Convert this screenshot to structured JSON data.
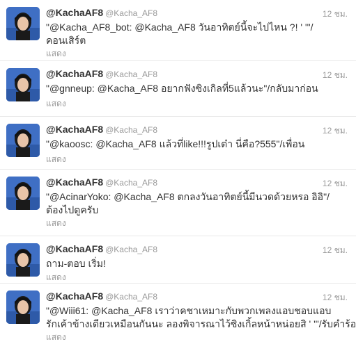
{
  "tweets": [
    {
      "name": "@KachaAF8",
      "handle": "@Kacha_AF8",
      "time": "12 ชม.",
      "lines": [
        "\"@Kacha_AF8_bot: @Kacha_AF8 วันอาทิตย์นี้จะไปไหน ?! ' '\"/",
        "คอนเสิร์ต"
      ],
      "expand": "แสดง"
    },
    {
      "name": "@KachaAF8",
      "handle": "@Kacha_AF8",
      "time": "12 ชม.",
      "lines": [
        "\"@gnneup: @Kacha_AF8 อยากฟังซิงเกิลที่5แล้วนะ\"/กลับมาก่อน"
      ],
      "expand": "แสดง"
    },
    {
      "name": "@KachaAF8",
      "handle": "@Kacha_AF8",
      "time": "12 ชม.",
      "lines": [
        "\"@kaoosc: @Kacha_AF8 แล้วที่like!!!รูปเต๋า นี่คือ?555\"/เพื่อน"
      ],
      "expand": "แสดง"
    },
    {
      "name": "@KachaAF8",
      "handle": "@Kacha_AF8",
      "time": "12 ชม.",
      "lines": [
        "\"@AcinarYoko: @Kacha_AF8 ตกลงวันอาทิตย์นี้มีนวดด้วยหรอ อิอิ\"/",
        "ต้องไปดูครับ"
      ],
      "expand": "แสดง"
    },
    {
      "name": "@KachaAF8",
      "handle": "@Kacha_AF8",
      "time": "12 ชม.",
      "lines": [
        "ถาม-ตอบ เริ่ม!"
      ],
      "expand": "แสดง"
    },
    {
      "name": "@KachaAF8",
      "handle": "@Kacha_AF8",
      "time": "12 ชม.",
      "lines": [
        "\"@Wiii61: @Kacha_AF8 เราว่าคชาเหมาะกับพวกเพลงแอบชอบแอบ",
        "รักเค้าข้างเดียวเหมือนกันนะ ลองพิจารณาไว้ซิงเกิ้ลหน้าหน่อยสิ ' '\"/รับคำร้อง"
      ],
      "expand": "แสดง"
    }
  ],
  "colors": {
    "name": "#333333",
    "meta": "#999999",
    "divider": "#e8e8e8",
    "avatar_bg": "#3f6fc4"
  }
}
